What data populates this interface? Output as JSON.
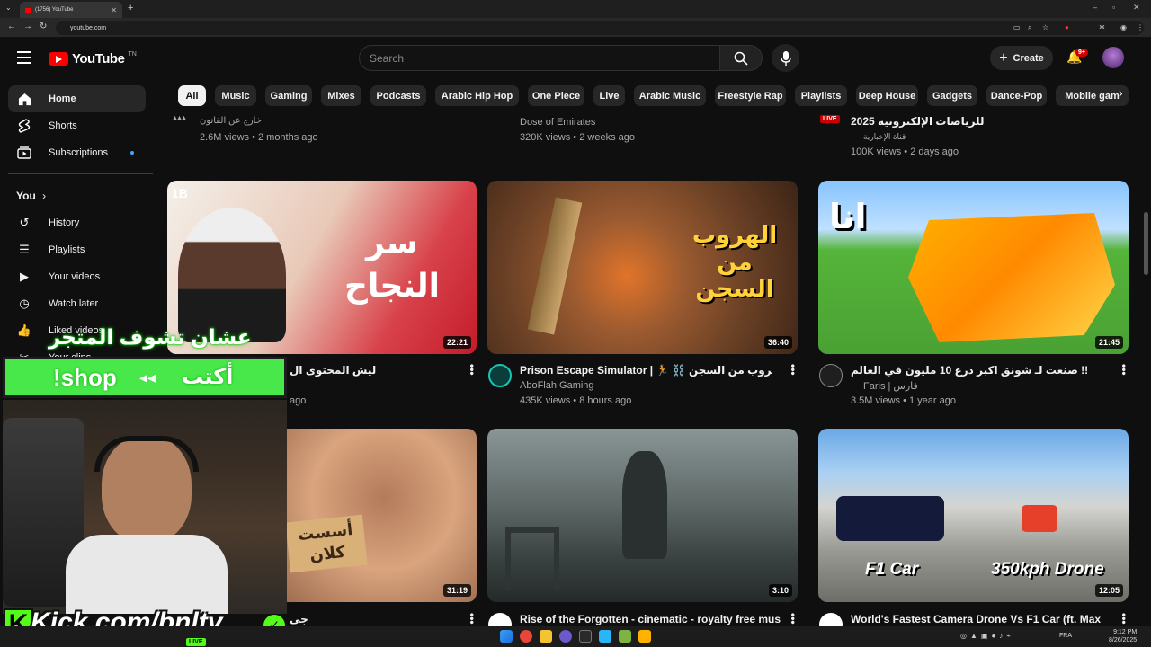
{
  "browser": {
    "tab_title": "(1756) YouTube",
    "url": "youtube.com",
    "new_tab_symbol": "+"
  },
  "header": {
    "logo_text": "YouTube",
    "country_code": "TN",
    "search_placeholder": "Search",
    "create_label": "Create",
    "notification_count": "9+"
  },
  "chips": [
    "All",
    "Music",
    "Gaming",
    "Mixes",
    "Podcasts",
    "Arabic Hip Hop",
    "One Piece",
    "Live",
    "Arabic Music",
    "Freestyle Rap",
    "Playlists",
    "Deep House",
    "Gadgets",
    "Dance-Pop",
    "Mobile gam"
  ],
  "sidebar": {
    "main": [
      {
        "label": "Home",
        "icon": "home-icon"
      },
      {
        "label": "Shorts",
        "icon": "shorts-icon"
      },
      {
        "label": "Subscriptions",
        "icon": "subscriptions-icon"
      }
    ],
    "you_header": "You",
    "you_items": [
      {
        "label": "History",
        "icon": "history-icon"
      },
      {
        "label": "Playlists",
        "icon": "playlists-icon"
      },
      {
        "label": "Your videos",
        "icon": "your-videos-icon"
      },
      {
        "label": "Watch later",
        "icon": "watch-later-icon"
      },
      {
        "label": "Liked videos",
        "icon": "liked-videos-icon"
      },
      {
        "label": "Your clips",
        "icon": "clips-icon"
      }
    ]
  },
  "top_row": [
    {
      "channel": "خارج عن القانون",
      "meta": "2.6M views • 2 months ago"
    },
    {
      "channel": "Dose of Emirates",
      "meta": "320K views • 2 weeks ago"
    },
    {
      "title": "للرياضات الإلكترونية 2025",
      "channel": "قناة الإخبارية",
      "meta": "100K views • 2 days ago",
      "live": "LIVE"
    }
  ],
  "videos_row2": [
    {
      "title": "ليش المحتوى ال",
      "duration": "22:21",
      "meta": "ago",
      "thumb_text": "سر النجاح",
      "thumb_badge": "1B"
    },
    {
      "title": "Prison Escape Simulator | 🏃 ⛓️ محاكي الهروب من السجن",
      "channel": "AboFlah Gaming",
      "meta": "435K views • 8 hours ago",
      "duration": "36:40",
      "thumb_text": "الهروب من السجن"
    },
    {
      "title": "صنعت لـ شونق اكبر درع 10 مليون في العالم !!",
      "channel": "Faris | فارس",
      "meta": "3.5M views • 1 year ago",
      "duration": "21:45",
      "thumb_text": "انا"
    }
  ],
  "videos_row3": [
    {
      "title": "جي",
      "duration": "31:19",
      "thumb_text": "أسست كلان"
    },
    {
      "title": "Rise of the Forgotten - cinematic - royalty free music",
      "duration": "3:10"
    },
    {
      "title": "World's Fastest Camera Drone Vs F1 Car (ft. Max",
      "duration": "12:05",
      "thumb_left": "F1 Car",
      "thumb_right": "350kph Drone"
    }
  ],
  "overlay": {
    "headline": "عشان تشوف المتجر",
    "shop": "!shop",
    "write": "أكتب",
    "kick_letter": "K",
    "kick_url": "Kick.com/bnltv",
    "live": "LIVE"
  },
  "taskbar": {
    "lang": "FRA",
    "time": "9:12 PM",
    "date": "8/26/2025"
  },
  "colors": {
    "background": "#0f0f0f",
    "youtube_red": "#ff0000",
    "kick_green": "#53fc18",
    "chip_bg": "#272727"
  }
}
